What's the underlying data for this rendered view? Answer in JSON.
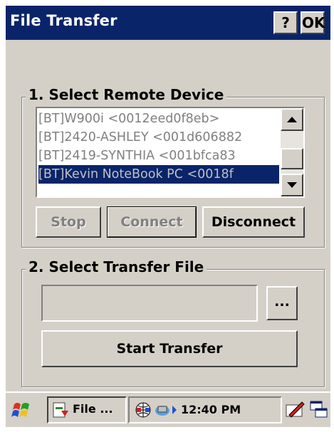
{
  "window": {
    "title": "File Transfer",
    "help_label": "?",
    "ok_label": "OK"
  },
  "section1": {
    "title": "1. Select Remote Device",
    "devices": [
      {
        "label": "[BT]W900i <0012eed0f8eb>",
        "selected": false
      },
      {
        "label": "[BT]2420-ASHLEY <001d606882",
        "selected": false
      },
      {
        "label": "[BT]2419-SYNTHIA <001bfca83",
        "selected": false
      },
      {
        "label": "[BT]Kevin NoteBook PC <0018f",
        "selected": true
      }
    ],
    "stop_label": "Stop",
    "connect_label": "Connect",
    "disconnect_label": "Disconnect"
  },
  "section2": {
    "title": "2. Select Transfer File",
    "file_path_value": "",
    "browse_label": "...",
    "start_label": "Start Transfer"
  },
  "taskbar": {
    "task_label": "File ...",
    "time": "12:40 PM"
  },
  "colors": {
    "title_bar": "#0a246a",
    "face": "#d4d0c8",
    "selection": "#0a246a"
  }
}
